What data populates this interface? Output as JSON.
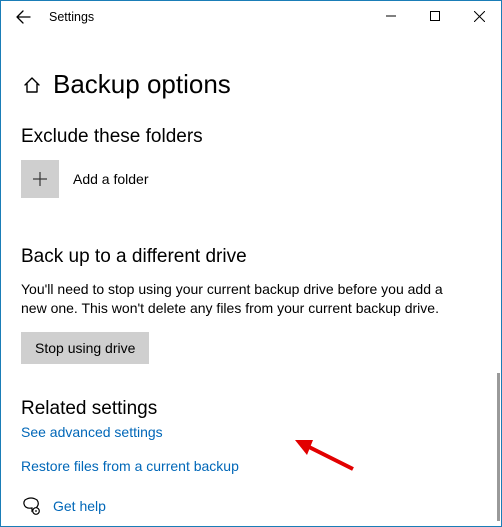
{
  "window": {
    "title": "Settings"
  },
  "page": {
    "title": "Backup options"
  },
  "exclude": {
    "heading": "Exclude these folders",
    "add_label": "Add a folder"
  },
  "diffdrive": {
    "heading": "Back up to a different drive",
    "desc": "You'll need to stop using your current backup drive before you add a new one. This won't delete any files from your current backup drive.",
    "button": "Stop using drive"
  },
  "related": {
    "heading": "Related settings",
    "advanced": "See advanced settings",
    "restore": "Restore files from a current backup"
  },
  "help": {
    "label": "Get help"
  }
}
